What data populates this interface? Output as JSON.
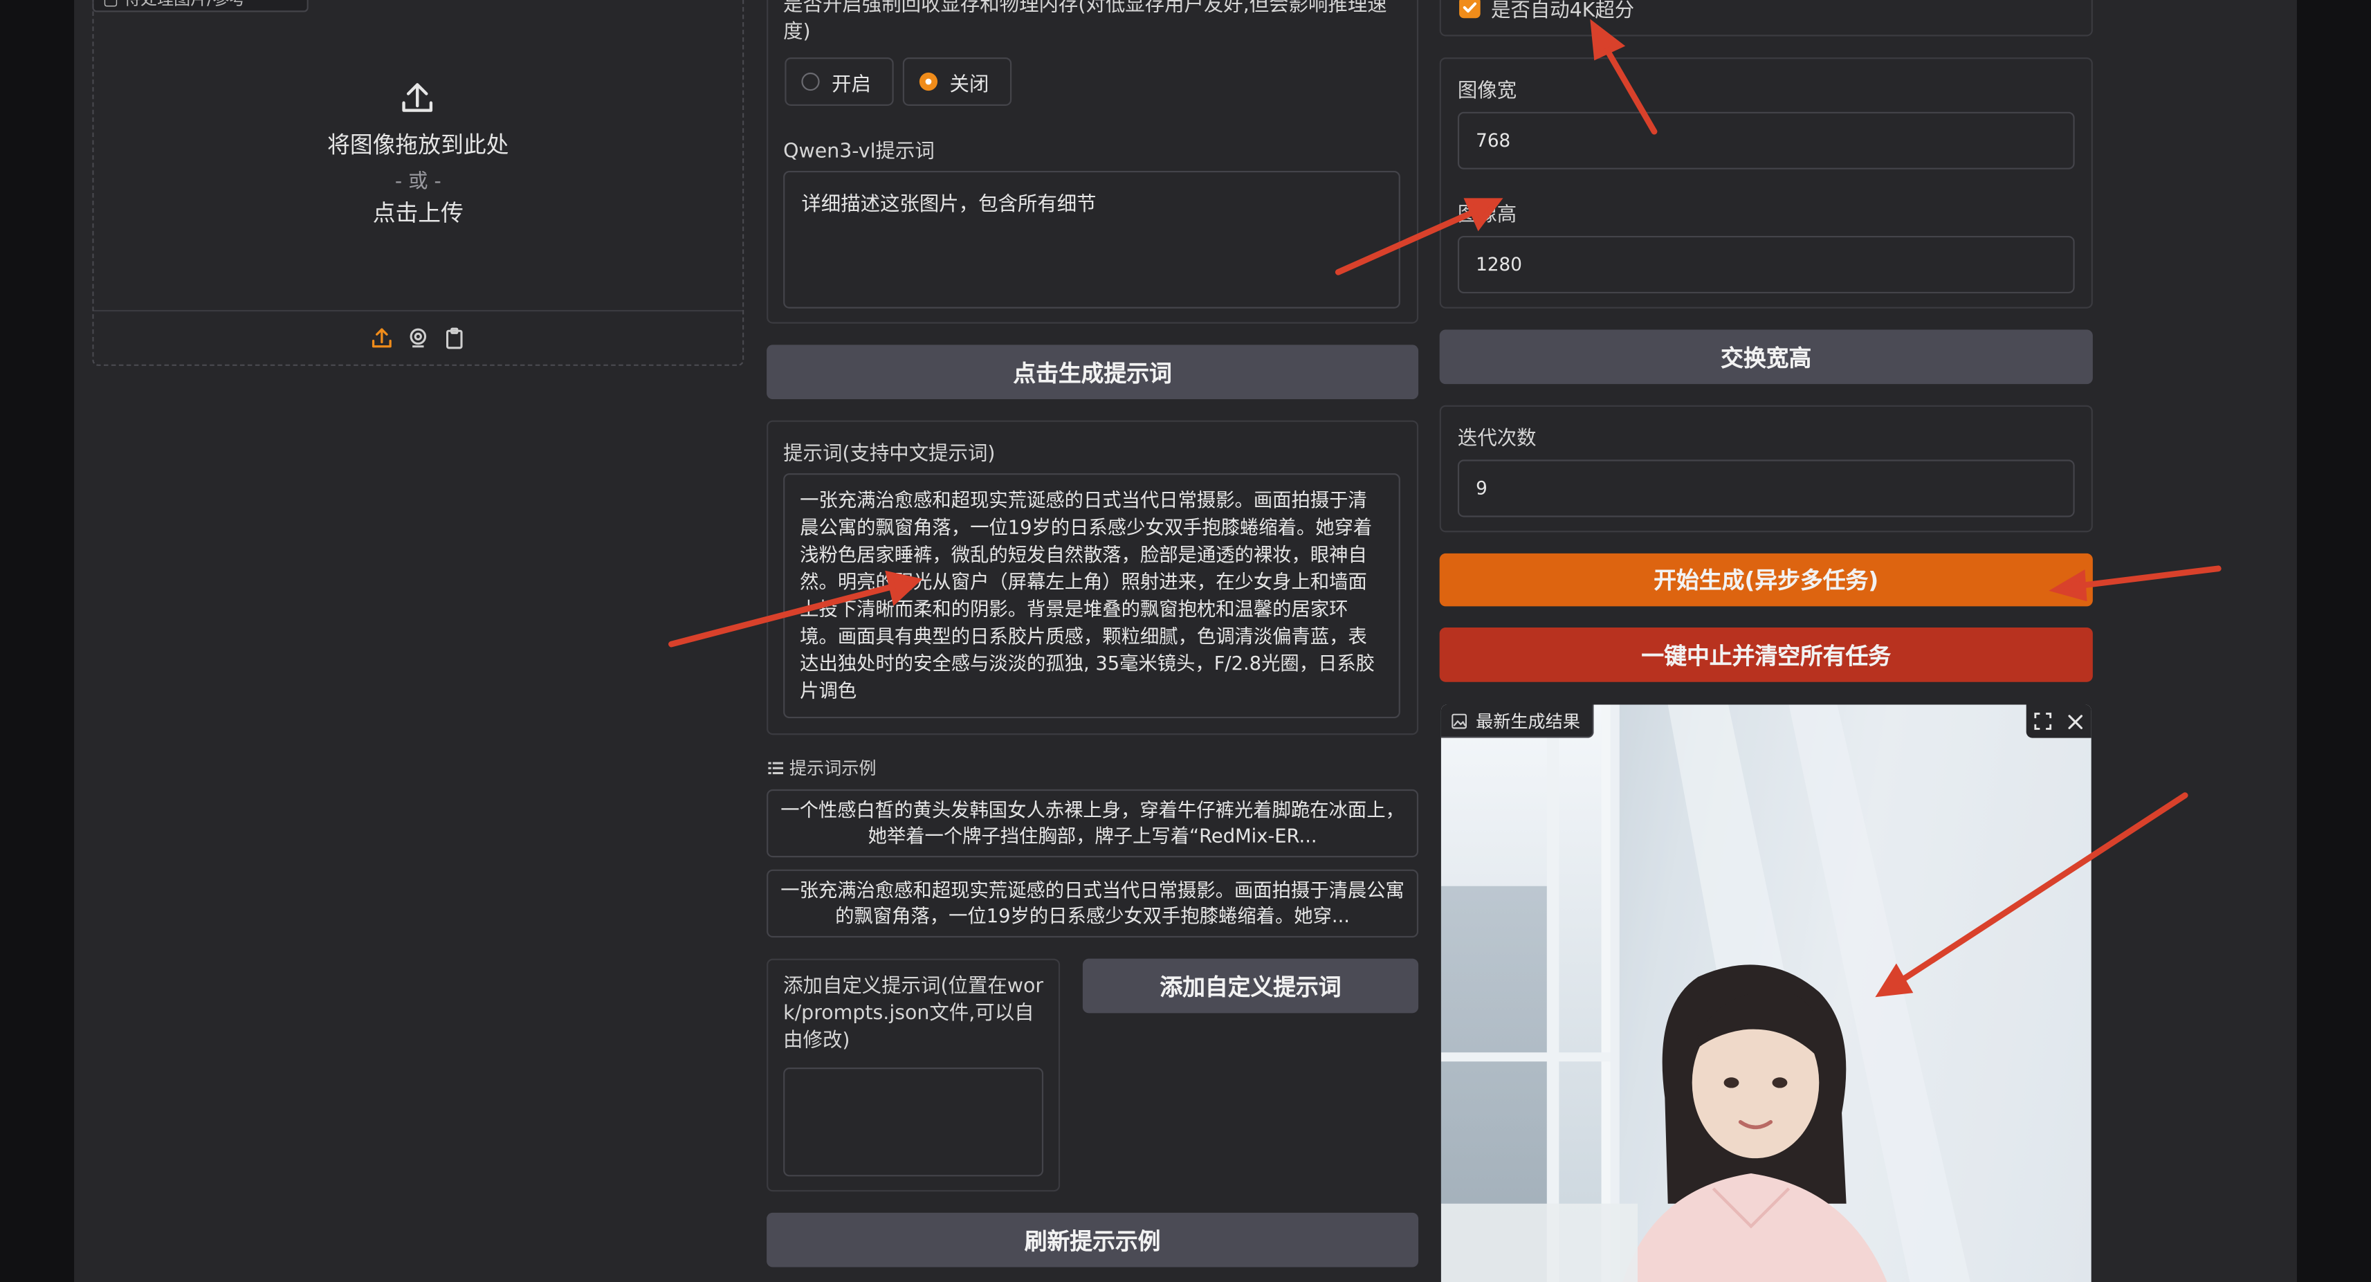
{
  "upload": {
    "top_tab_label": "▢ 待处理图片/参考",
    "drop_text": "将图像拖放到此处",
    "or_text": "- 或 -",
    "click_text": "点击上传",
    "tools": [
      "upload-icon",
      "webcam-icon",
      "clipboard-icon"
    ]
  },
  "memory": {
    "label": "是否开启强制回收显存和物理内存(对低显存用户友好,但会影响推理速度)",
    "options": [
      "开启",
      "关闭"
    ],
    "selected": "关闭"
  },
  "qwen": {
    "label": "Qwen3-vl提示词",
    "value": "详细描述这张图片，包含所有细节",
    "button": "点击生成提示词"
  },
  "prompt": {
    "label": "提示词(支持中文提示词)",
    "value": "一张充满治愈感和超现实荒诞感的日式当代日常摄影。画面拍摄于清晨公寓的飘窗角落，一位19岁的日系感少女双手抱膝蜷缩着。她穿着浅粉色居家睡裤，微乱的短发自然散落，脸部是通透的裸妆，眼神自然。明亮的阳光从窗户（屏幕左上角）照射进来，在少女身上和墙面上投下清晰而柔和的阴影。背景是堆叠的飘窗抱枕和温馨的居家环境。画面具有典型的日系胶片质感，颗粒细腻，色调清淡偏青蓝，表达出独处时的安全感与淡淡的孤独, 35毫米镜头，F/2.8光圈，日系胶片调色"
  },
  "examples": {
    "header": "提示词示例",
    "items": [
      "一个性感白皙的黄头发韩国女人赤裸上身，穿着牛仔裤光着脚跪在冰面上，她举着一个牌子挡住胸部，牌子上写着“RedMix-ER...",
      "一张充满治愈感和超现实荒诞感的日式当代日常摄影。画面拍摄于清晨公寓的飘窗角落，一位19岁的日系感少女双手抱膝蜷缩着。她穿..."
    ]
  },
  "custom": {
    "label": "添加自定义提示词(位置在work/prompts.json文件,可以自由修改)",
    "value": "",
    "add_button": "添加自定义提示词",
    "refresh_button": "刷新提示示例"
  },
  "settings": {
    "upscale_label": "是否自动4K超分",
    "upscale_checked": true,
    "width_label": "图像宽",
    "width_value": "768",
    "height_label": "图像高",
    "height_value": "1280",
    "swap_button": "交换宽高",
    "steps_label": "迭代次数",
    "steps_value": "9",
    "start_button": "开始生成(异步多任务)",
    "stop_button": "一键中止并清空所有任务"
  },
  "result": {
    "label": "最新生成结果"
  },
  "colors": {
    "page_bg": "#27272a",
    "outer_bg": "#111113",
    "accent_orange": "#dd6410",
    "danger_red": "#b8321f",
    "button_gray": "#4b4b55",
    "annotation_arrow": "#d9412b"
  }
}
